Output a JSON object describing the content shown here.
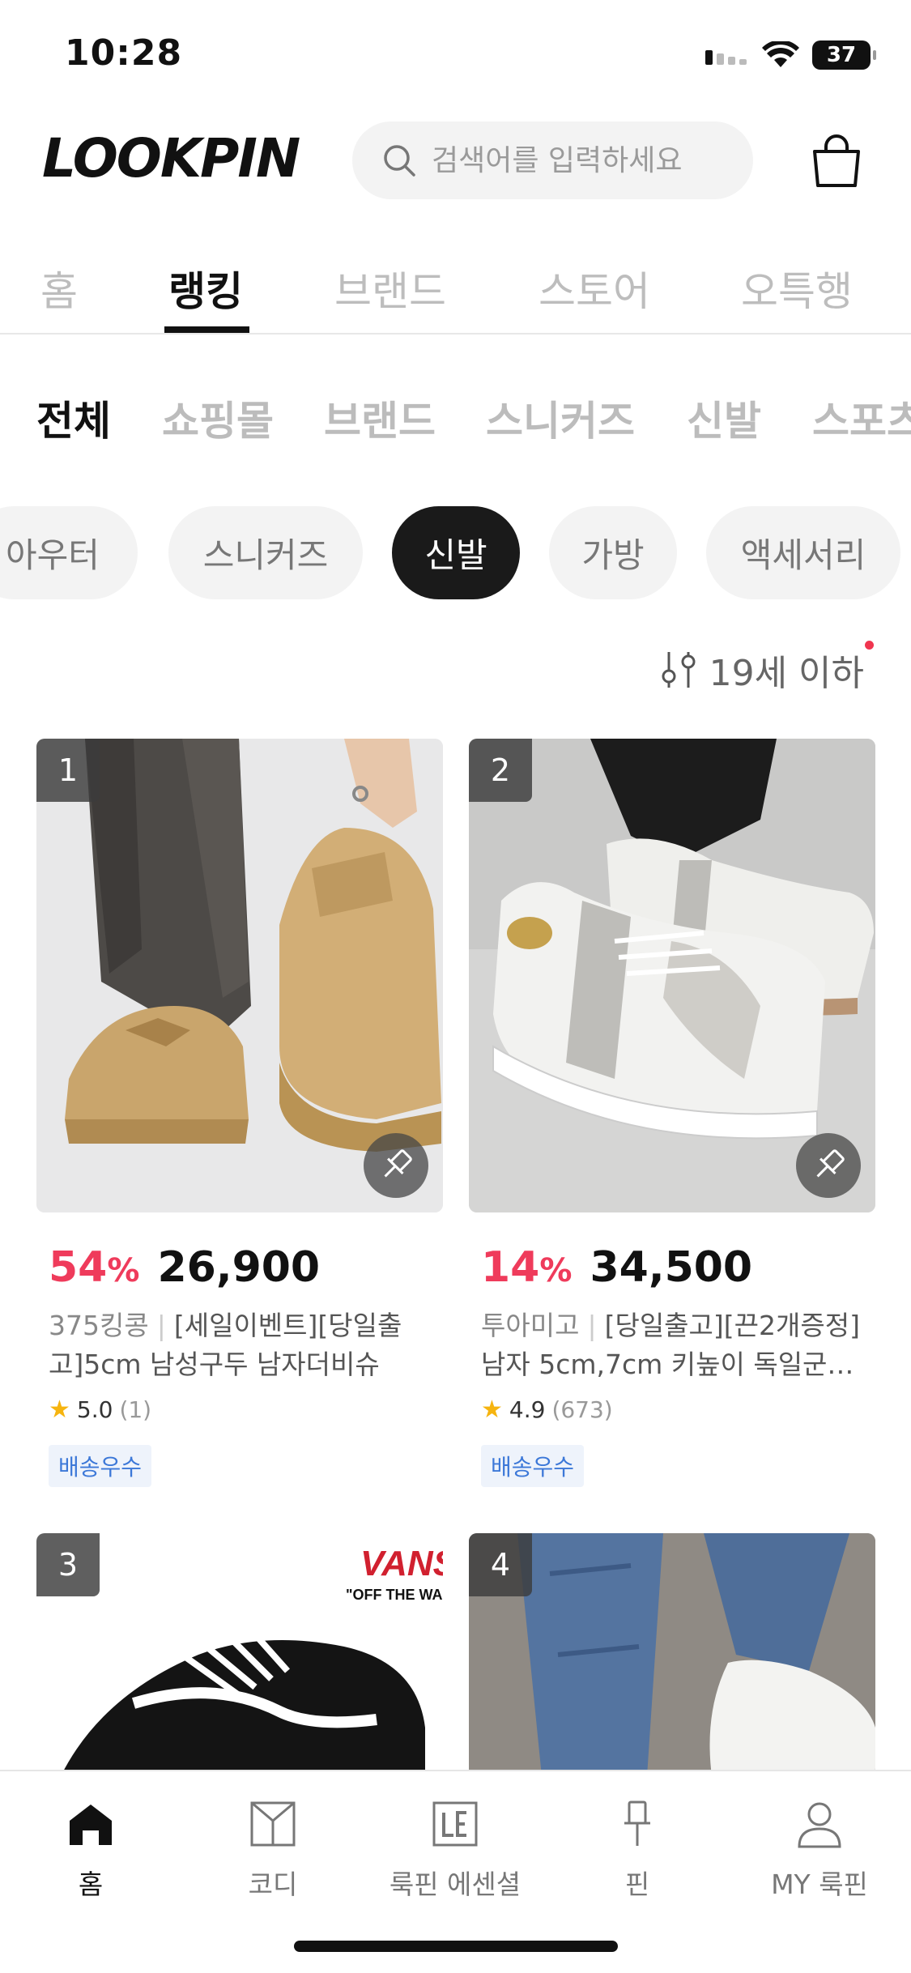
{
  "status_bar": {
    "time": "10:28",
    "battery": "37"
  },
  "header": {
    "logo": "LOOKPIN",
    "search_placeholder": "검색어를 입력하세요"
  },
  "main_tabs": [
    {
      "label": "홈",
      "active": false
    },
    {
      "label": "랭킹",
      "active": true
    },
    {
      "label": "브랜드",
      "active": false
    },
    {
      "label": "스토어",
      "active": false
    },
    {
      "label": "오특행",
      "active": false
    }
  ],
  "sub_tabs": [
    {
      "label": "전체",
      "active": true
    },
    {
      "label": "쇼핑몰",
      "active": false
    },
    {
      "label": "브랜드",
      "active": false
    },
    {
      "label": "스니커즈",
      "active": false
    },
    {
      "label": "신발",
      "active": false
    },
    {
      "label": "스포츠",
      "active": false
    }
  ],
  "chips": [
    {
      "label": "아우터",
      "active": false
    },
    {
      "label": "스니커즈",
      "active": false
    },
    {
      "label": "신발",
      "active": true
    },
    {
      "label": "가방",
      "active": false
    },
    {
      "label": "액세서리",
      "active": false
    }
  ],
  "filter": {
    "label": "19세 이하"
  },
  "products": [
    {
      "rank": "1",
      "discount": "54",
      "discount_unit": "%",
      "price": "26,900",
      "brand": "375킹콩",
      "title": "[세일이벤트][당일출고]5cm 남성구두 남자더비슈즈…",
      "rating": "5.0",
      "review_count": "(1)",
      "badge": "배송우수"
    },
    {
      "rank": "2",
      "discount": "14",
      "discount_unit": "%",
      "price": "34,500",
      "brand": "투아미고",
      "title": "[당일출고][끈2개증정] 남자 5cm,7cm 키높이 독일군…",
      "rating": "4.9",
      "review_count": "(673)",
      "badge": "배송우수"
    },
    {
      "rank": "3",
      "image_text_1": "VANS",
      "image_text_2": "\"OFF THE WA"
    },
    {
      "rank": "4"
    }
  ],
  "bottom_nav": [
    {
      "label": "홈",
      "icon": "home-icon",
      "active": true
    },
    {
      "label": "코디",
      "icon": "coordi-icon",
      "active": false
    },
    {
      "label": "룩핀 에센셜",
      "icon": "essential-icon",
      "active": false
    },
    {
      "label": "핀",
      "icon": "pin-icon",
      "active": false
    },
    {
      "label": "MY 룩핀",
      "icon": "profile-icon",
      "active": false
    }
  ],
  "colors": {
    "accent_discount": "#ef3b5b",
    "delivery_badge": "#3c78d8",
    "star": "#f6b40f"
  }
}
